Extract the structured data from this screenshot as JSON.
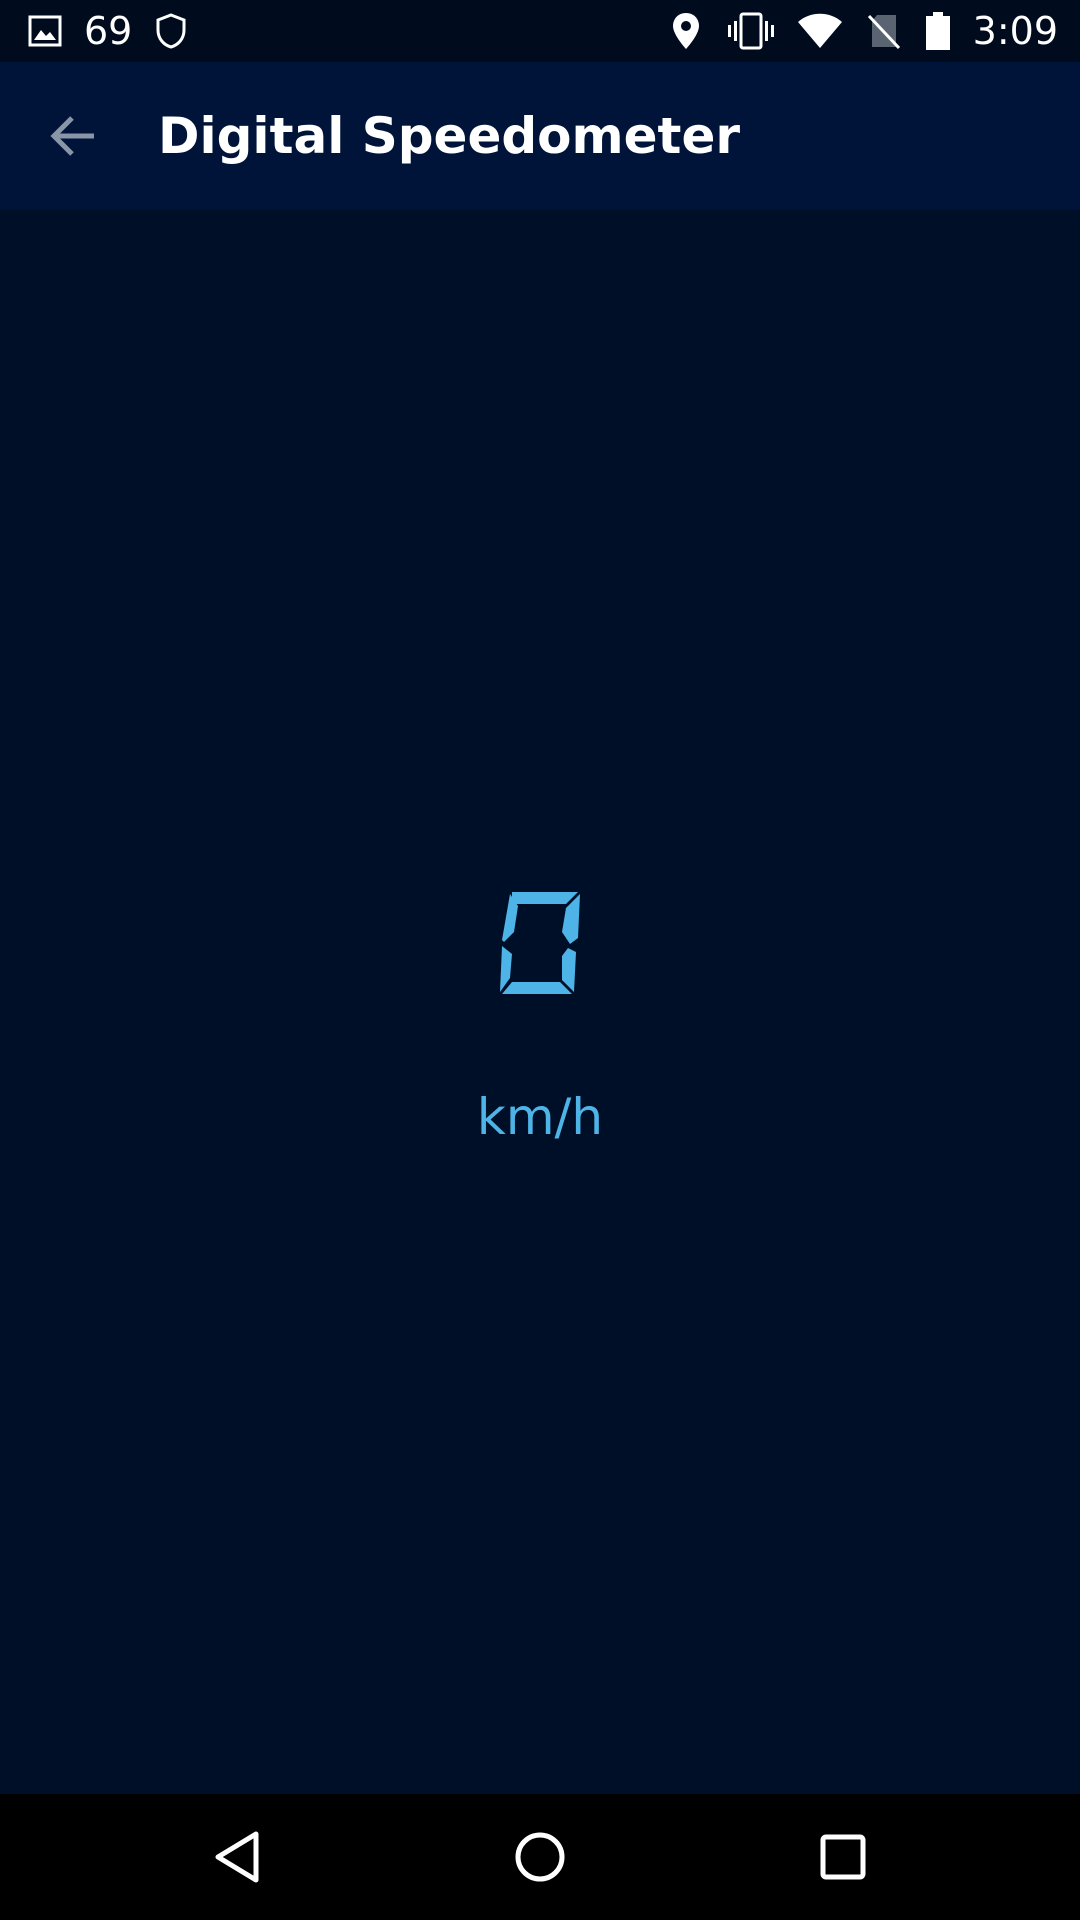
{
  "status_bar": {
    "notification_count": "69",
    "time": "3:09",
    "icons": [
      "image-icon",
      "shield-icon",
      "location-icon",
      "vibrate-icon",
      "wifi-icon",
      "no-sim-icon",
      "battery-icon"
    ]
  },
  "app_bar": {
    "title": "Digital Speedometer",
    "back_icon": "arrow-back-icon"
  },
  "speedometer": {
    "speed_value": "0",
    "unit": "km/h",
    "digit_color": "#4eb4e8"
  },
  "nav_bar": {
    "icons": [
      "nav-back-icon",
      "nav-home-icon",
      "nav-recents-icon"
    ]
  },
  "colors": {
    "background": "#000f28",
    "app_bar": "#00143a",
    "status_bar": "#000c1d",
    "accent": "#4eb4e8"
  }
}
